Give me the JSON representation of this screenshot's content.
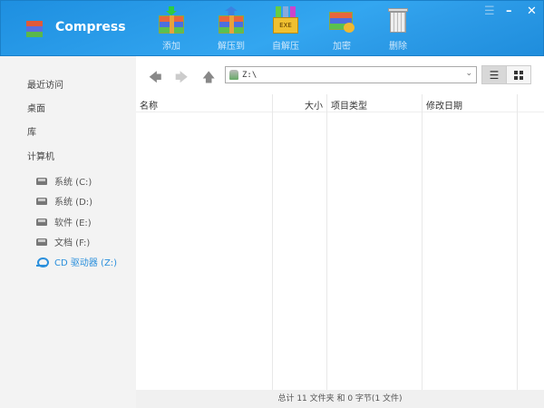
{
  "app": {
    "title": "Compress"
  },
  "toolbar": [
    {
      "label": "添加",
      "icon": "archive-add-icon"
    },
    {
      "label": "解压到",
      "icon": "archive-extract-icon"
    },
    {
      "label": "自解压",
      "icon": "exe-sfx-icon",
      "badge": "EXE"
    },
    {
      "label": "加密",
      "icon": "archive-lock-icon"
    },
    {
      "label": "删除",
      "icon": "trash-icon"
    }
  ],
  "window": {
    "minimize": "–",
    "close": "✕"
  },
  "sidebar": {
    "items": [
      "最近访问",
      "桌面",
      "库",
      "计算机"
    ],
    "drives": [
      {
        "label": "系统 (C:)",
        "type": "hdd"
      },
      {
        "label": "系统 (D:)",
        "type": "hdd"
      },
      {
        "label": "软件 (E:)",
        "type": "hdd"
      },
      {
        "label": "文档 (F:)",
        "type": "hdd"
      },
      {
        "label": "CD 驱动器 (Z:)",
        "type": "cd",
        "active": true
      }
    ]
  },
  "address": {
    "value": "Z:\\"
  },
  "columns": [
    "名称",
    "大小",
    "项目类型",
    "修改日期"
  ],
  "status": "总计 11 文件夹  和  0 字节(1 文件)",
  "colors": {
    "accent": "#2a8fdc",
    "header": "#2d9ce8"
  }
}
